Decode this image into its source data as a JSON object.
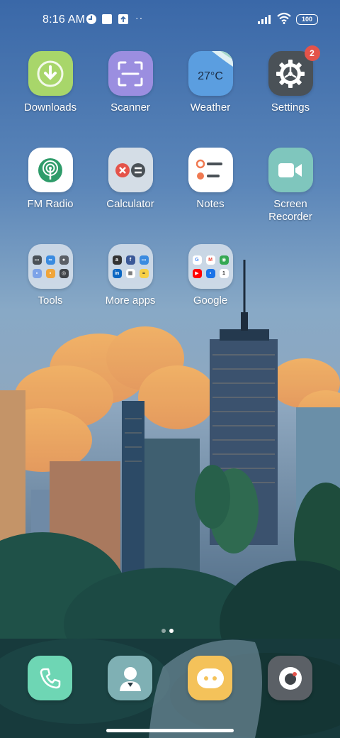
{
  "status_bar": {
    "time": "8:16 AM",
    "battery": "100",
    "icons": [
      "clock-alert-icon",
      "square-notification-icon",
      "upload-notification-icon",
      "more-dots-icon",
      "signal-icon",
      "wifi-icon",
      "battery-icon"
    ],
    "dots": "··"
  },
  "apps": [
    {
      "label": "Downloads",
      "icon": "download-icon",
      "color": "#a8d66a"
    },
    {
      "label": "Scanner",
      "icon": "scanner-icon",
      "color": "#9b8ee0"
    },
    {
      "label": "Weather",
      "icon": "weather-icon",
      "color": "#5b9ee0",
      "temperature": "27°C"
    },
    {
      "label": "Settings",
      "icon": "gear-icon",
      "color": "#4a5157",
      "badge": "2"
    },
    {
      "label": "FM Radio",
      "icon": "radio-icon",
      "color": "#ffffff"
    },
    {
      "label": "Calculator",
      "icon": "calculator-icon",
      "color": "#d4dde6"
    },
    {
      "label": "Notes",
      "icon": "notes-icon",
      "color": "#ffffff"
    },
    {
      "label": "Screen\nRecorder",
      "label_line1": "Screen",
      "label_line2": "Recorder",
      "icon": "video-camera-icon",
      "color": "#7fc6bd"
    },
    {
      "label": "Tools",
      "icon": "folder-icon"
    },
    {
      "label": "More apps",
      "icon": "folder-icon"
    },
    {
      "label": "Google",
      "icon": "folder-icon"
    }
  ],
  "dock": [
    {
      "name": "phone",
      "icon": "phone-icon",
      "color": "#6ed6b4"
    },
    {
      "name": "contacts",
      "icon": "contact-icon",
      "color": "#7fb0b4"
    },
    {
      "name": "messages",
      "icon": "message-icon",
      "color": "#f4c25a"
    },
    {
      "name": "camera",
      "icon": "camera-icon",
      "color": "#5b6066"
    }
  ],
  "page_indicator": {
    "pages": 2,
    "current": 2
  },
  "colors": {
    "badge": "#e4534a",
    "text": "#ffffff"
  }
}
